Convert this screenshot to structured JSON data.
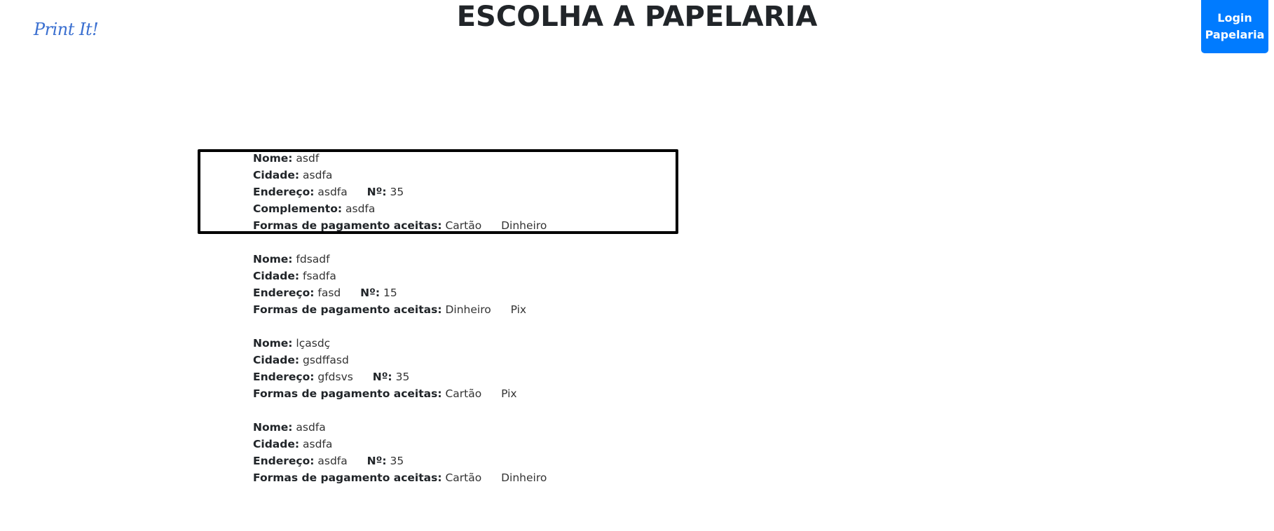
{
  "header": {
    "logo_text": "Print It!",
    "title": "ESCOLHA A PAPELARIA",
    "login_button_label": "Login\nPapelaria"
  },
  "labels": {
    "nome": "Nome:",
    "cidade": "Cidade:",
    "endereco": "Endereço:",
    "numero": "Nº:",
    "complemento": "Complemento:",
    "pagamento": "Formas de pagamento aceitas:"
  },
  "stores": [
    {
      "nome": "asdf",
      "cidade": "asdfa",
      "endereco": "asdfa",
      "numero": "35",
      "complemento": "asdfa",
      "pagamentos": [
        "Cartão",
        "Dinheiro"
      ],
      "selected": true
    },
    {
      "nome": "fdsadf",
      "cidade": "fsadfa",
      "endereco": "fasd",
      "numero": "15",
      "complemento": null,
      "pagamentos": [
        "Dinheiro",
        "Pix"
      ],
      "selected": false
    },
    {
      "nome": "lçasdç",
      "cidade": "gsdffasd",
      "endereco": "gfdsvs",
      "numero": "35",
      "complemento": null,
      "pagamentos": [
        "Cartão",
        "Pix"
      ],
      "selected": false
    },
    {
      "nome": "asdfa",
      "cidade": "asdfa",
      "endereco": "asdfa",
      "numero": "35",
      "complemento": null,
      "pagamentos": [
        "Cartão",
        "Dinheiro"
      ],
      "selected": false
    }
  ],
  "colors": {
    "primary": "#007bff",
    "logo": "#3a6fd0",
    "selected_border": "#000000"
  }
}
